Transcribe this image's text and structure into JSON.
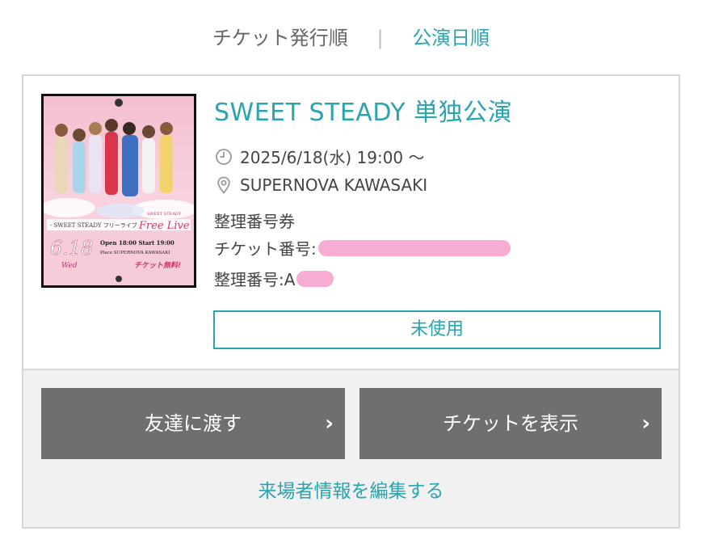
{
  "sort": {
    "issued_order": "チケット発行順",
    "separator": "|",
    "date_order": "公演日順"
  },
  "ticket": {
    "title": "SWEET STEADY 単独公演",
    "datetime": "2025/6/18(水) 19:00 ～",
    "venue": "SUPERNOVA KAWASAKI",
    "ticket_type": "整理番号券",
    "ticket_number_label": "チケット番号:",
    "seat_number_label": "整理番号:A",
    "status": "未使用"
  },
  "poster": {
    "top_text": "SWEET STEADY",
    "event_line": "- SWEET STEADY フリーライブ",
    "free_live": "Free Live",
    "date": "6.18",
    "weekday": "Wed",
    "open_start": "Open 18:00 Start 19:00",
    "place": "Place SUPERNOVA KAWASAKI",
    "free_admission": "チケット無料!"
  },
  "actions": {
    "give_to_friend": "友達に渡す",
    "show_ticket": "チケットを表示",
    "chevron": "›",
    "edit_visitor_info": "来場者情報を編集する"
  },
  "icons": {
    "clock": "clock-icon",
    "location": "location-pin-icon",
    "chevron": "chevron-right-icon"
  },
  "colors": {
    "accent": "#2aa4ae",
    "button": "#6f6f6f",
    "redaction": "#f7a8d2"
  }
}
